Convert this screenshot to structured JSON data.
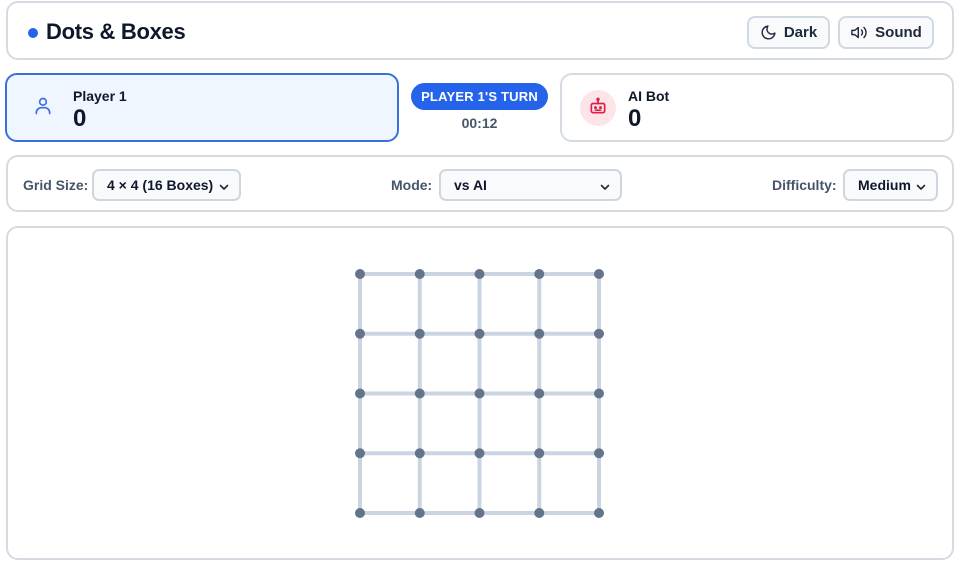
{
  "header": {
    "title": "Dots & Boxes",
    "accent_color": "#2563eb",
    "dark_button": {
      "label": "Dark",
      "icon": "moon-icon"
    },
    "sound_button": {
      "label": "Sound",
      "icon": "speaker-icon"
    }
  },
  "players": [
    {
      "name": "Player 1",
      "score": "0",
      "icon": "user-icon",
      "active": true
    },
    {
      "name": "AI Bot",
      "score": "0",
      "icon": "robot-icon",
      "active": false
    }
  ],
  "turn": {
    "label": "PLAYER 1'S TURN",
    "timer": "00:12"
  },
  "controls": {
    "grid_size": {
      "label": "Grid Size:",
      "value": "4 × 4 (16 Boxes)"
    },
    "mode": {
      "label": "Mode:",
      "value": "vs AI"
    },
    "difficulty": {
      "label": "Difficulty:",
      "value": "Medium"
    }
  },
  "board": {
    "rows_of_dots": 5,
    "cols_of_dots": 5,
    "dot_color": "#64748b",
    "line_color": "#cbd5e1"
  }
}
